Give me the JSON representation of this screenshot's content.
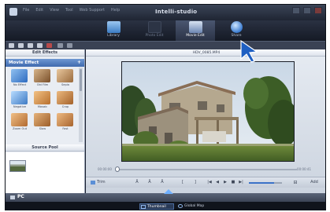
{
  "window": {
    "title": "Intelli-studio",
    "menu": [
      "File",
      "Edit",
      "View",
      "Tool",
      "Web Support",
      "Help"
    ]
  },
  "modes": [
    {
      "label": "Library",
      "icon": "library-icon"
    },
    {
      "label": "Photo Edit",
      "icon": "photo-edit-icon"
    },
    {
      "label": "Movie Edit",
      "icon": "movie-edit-icon",
      "active": true
    },
    {
      "label": "Share",
      "icon": "share-icon"
    }
  ],
  "left_panel": {
    "edit_effects_title": "Edit Effects",
    "category_label": "Movie Effect",
    "effects": [
      {
        "label": "No Effect",
        "color": "#3a78c8"
      },
      {
        "label": "Old Film",
        "color": "#9a6b3a"
      },
      {
        "label": "Sepia",
        "color": "#b07a48"
      },
      {
        "label": "Negative",
        "color": "#4f87c7"
      },
      {
        "label": "Mosaic",
        "color": "#d08a44"
      },
      {
        "label": "Crop",
        "color": "#c47a3a"
      },
      {
        "label": "Zoom Out",
        "color": "#c8843f"
      },
      {
        "label": "Slow",
        "color": "#b9783e"
      },
      {
        "label": "Fast",
        "color": "#c07d44"
      }
    ],
    "source_pool_title": "Source Pool"
  },
  "preview": {
    "filename": "HDV_0085.MP4",
    "time_start": "00:00:00",
    "time_end": "00:00:41",
    "seek_position": 0.0,
    "volume": 0.75
  },
  "controls": {
    "trim_label": "Trim",
    "add_label": "Add",
    "buttons": [
      "[",
      "]",
      "|◀",
      "◀",
      "▶",
      "■",
      "▶|"
    ]
  },
  "bottom": {
    "device_label": "PC",
    "view_tabs": [
      {
        "label": "Thumbnail",
        "active": true
      },
      {
        "label": "Global Map",
        "active": false
      }
    ]
  }
}
